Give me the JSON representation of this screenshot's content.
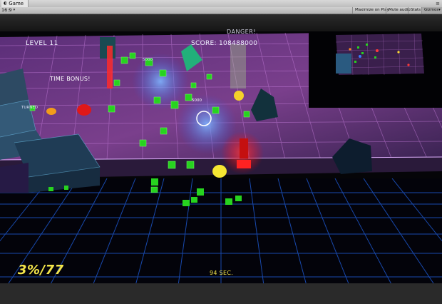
{
  "window": {
    "tab_title": "Game",
    "tab_icon": "game-view-icon",
    "menu_glyph": "≡"
  },
  "toolbar": {
    "aspect": "16:9",
    "maximize_label": "Maximize on Play",
    "mute_label": "Mute audio",
    "stats_label": "Stats",
    "gizmos_label": "Gizmos"
  },
  "hud": {
    "level": "LEVEL 11",
    "score": "SCORE: 108488000",
    "danger": "DANGER!",
    "time_bonus": "TIME BONUS!",
    "turned": "TURNED",
    "points_popup_1": "5000",
    "points_popup_2": "5000",
    "progress": "3%/77",
    "timer": "94 SEC."
  },
  "colors": {
    "hud_text": "#f0f0ff",
    "hud_yellow": "#f4e64a",
    "grid_line": "#c27ad8",
    "floor_grid": "#1e5bd6",
    "cube_green": "#27d31f"
  }
}
